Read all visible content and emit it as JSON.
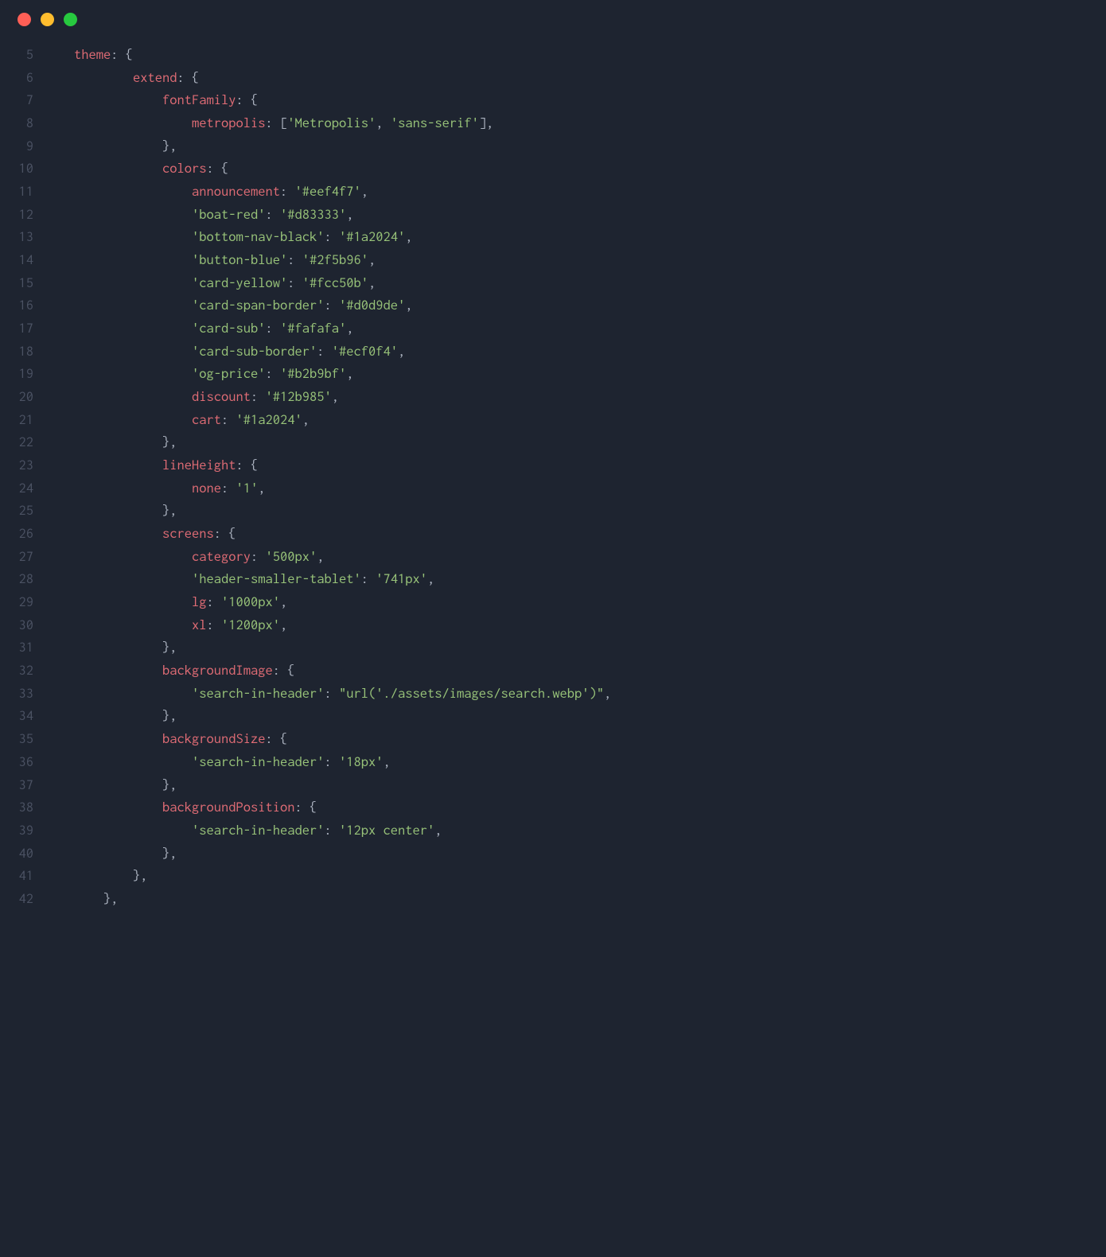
{
  "titlebar": {
    "red": "red",
    "yellow": "yellow",
    "green": "green"
  },
  "lines": [
    {
      "n": "5",
      "tokens": [
        {
          "t": "    ",
          "c": "punc"
        },
        {
          "t": "theme",
          "c": "key"
        },
        {
          "t": ": {",
          "c": "punc"
        }
      ]
    },
    {
      "n": "6",
      "tokens": [
        {
          "t": "            ",
          "c": "punc"
        },
        {
          "t": "extend",
          "c": "key"
        },
        {
          "t": ": {",
          "c": "punc"
        }
      ]
    },
    {
      "n": "7",
      "tokens": [
        {
          "t": "                ",
          "c": "punc"
        },
        {
          "t": "fontFamily",
          "c": "key"
        },
        {
          "t": ": {",
          "c": "punc"
        }
      ]
    },
    {
      "n": "8",
      "tokens": [
        {
          "t": "                    ",
          "c": "punc"
        },
        {
          "t": "metropolis",
          "c": "key"
        },
        {
          "t": ": [",
          "c": "punc"
        },
        {
          "t": "'Metropolis'",
          "c": "str"
        },
        {
          "t": ", ",
          "c": "punc"
        },
        {
          "t": "'sans-serif'",
          "c": "str"
        },
        {
          "t": "],",
          "c": "punc"
        }
      ]
    },
    {
      "n": "9",
      "tokens": [
        {
          "t": "                },",
          "c": "punc"
        }
      ]
    },
    {
      "n": "10",
      "tokens": [
        {
          "t": "                ",
          "c": "punc"
        },
        {
          "t": "colors",
          "c": "key"
        },
        {
          "t": ": {",
          "c": "punc"
        }
      ]
    },
    {
      "n": "11",
      "tokens": [
        {
          "t": "                    ",
          "c": "punc"
        },
        {
          "t": "announcement",
          "c": "key"
        },
        {
          "t": ": ",
          "c": "punc"
        },
        {
          "t": "'#eef4f7'",
          "c": "str"
        },
        {
          "t": ",",
          "c": "punc"
        }
      ]
    },
    {
      "n": "12",
      "tokens": [
        {
          "t": "                    ",
          "c": "punc"
        },
        {
          "t": "'boat-red'",
          "c": "str"
        },
        {
          "t": ": ",
          "c": "punc"
        },
        {
          "t": "'#d83333'",
          "c": "str"
        },
        {
          "t": ",",
          "c": "punc"
        }
      ]
    },
    {
      "n": "13",
      "tokens": [
        {
          "t": "                    ",
          "c": "punc"
        },
        {
          "t": "'bottom-nav-black'",
          "c": "str"
        },
        {
          "t": ": ",
          "c": "punc"
        },
        {
          "t": "'#1a2024'",
          "c": "str"
        },
        {
          "t": ",",
          "c": "punc"
        }
      ]
    },
    {
      "n": "14",
      "tokens": [
        {
          "t": "                    ",
          "c": "punc"
        },
        {
          "t": "'button-blue'",
          "c": "str"
        },
        {
          "t": ": ",
          "c": "punc"
        },
        {
          "t": "'#2f5b96'",
          "c": "str"
        },
        {
          "t": ",",
          "c": "punc"
        }
      ]
    },
    {
      "n": "15",
      "tokens": [
        {
          "t": "                    ",
          "c": "punc"
        },
        {
          "t": "'card-yellow'",
          "c": "str"
        },
        {
          "t": ": ",
          "c": "punc"
        },
        {
          "t": "'#fcc50b'",
          "c": "str"
        },
        {
          "t": ",",
          "c": "punc"
        }
      ]
    },
    {
      "n": "16",
      "tokens": [
        {
          "t": "                    ",
          "c": "punc"
        },
        {
          "t": "'card-span-border'",
          "c": "str"
        },
        {
          "t": ": ",
          "c": "punc"
        },
        {
          "t": "'#d0d9de'",
          "c": "str"
        },
        {
          "t": ",",
          "c": "punc"
        }
      ]
    },
    {
      "n": "17",
      "tokens": [
        {
          "t": "                    ",
          "c": "punc"
        },
        {
          "t": "'card-sub'",
          "c": "str"
        },
        {
          "t": ": ",
          "c": "punc"
        },
        {
          "t": "'#fafafa'",
          "c": "str"
        },
        {
          "t": ",",
          "c": "punc"
        }
      ]
    },
    {
      "n": "18",
      "tokens": [
        {
          "t": "                    ",
          "c": "punc"
        },
        {
          "t": "'card-sub-border'",
          "c": "str"
        },
        {
          "t": ": ",
          "c": "punc"
        },
        {
          "t": "'#ecf0f4'",
          "c": "str"
        },
        {
          "t": ",",
          "c": "punc"
        }
      ]
    },
    {
      "n": "19",
      "tokens": [
        {
          "t": "                    ",
          "c": "punc"
        },
        {
          "t": "'og-price'",
          "c": "str"
        },
        {
          "t": ": ",
          "c": "punc"
        },
        {
          "t": "'#b2b9bf'",
          "c": "str"
        },
        {
          "t": ",",
          "c": "punc"
        }
      ]
    },
    {
      "n": "20",
      "tokens": [
        {
          "t": "                    ",
          "c": "punc"
        },
        {
          "t": "discount",
          "c": "key"
        },
        {
          "t": ": ",
          "c": "punc"
        },
        {
          "t": "'#12b985'",
          "c": "str"
        },
        {
          "t": ",",
          "c": "punc"
        }
      ]
    },
    {
      "n": "21",
      "tokens": [
        {
          "t": "                    ",
          "c": "punc"
        },
        {
          "t": "cart",
          "c": "key"
        },
        {
          "t": ": ",
          "c": "punc"
        },
        {
          "t": "'#1a2024'",
          "c": "str"
        },
        {
          "t": ",",
          "c": "punc"
        }
      ]
    },
    {
      "n": "22",
      "tokens": [
        {
          "t": "                },",
          "c": "punc"
        }
      ]
    },
    {
      "n": "23",
      "tokens": [
        {
          "t": "                ",
          "c": "punc"
        },
        {
          "t": "lineHeight",
          "c": "key"
        },
        {
          "t": ": {",
          "c": "punc"
        }
      ]
    },
    {
      "n": "24",
      "tokens": [
        {
          "t": "                    ",
          "c": "punc"
        },
        {
          "t": "none",
          "c": "key"
        },
        {
          "t": ": ",
          "c": "punc"
        },
        {
          "t": "'1'",
          "c": "str"
        },
        {
          "t": ",",
          "c": "punc"
        }
      ]
    },
    {
      "n": "25",
      "tokens": [
        {
          "t": "                },",
          "c": "punc"
        }
      ]
    },
    {
      "n": "26",
      "tokens": [
        {
          "t": "                ",
          "c": "punc"
        },
        {
          "t": "screens",
          "c": "key"
        },
        {
          "t": ": {",
          "c": "punc"
        }
      ]
    },
    {
      "n": "27",
      "tokens": [
        {
          "t": "                    ",
          "c": "punc"
        },
        {
          "t": "category",
          "c": "key"
        },
        {
          "t": ": ",
          "c": "punc"
        },
        {
          "t": "'500px'",
          "c": "str"
        },
        {
          "t": ",",
          "c": "punc"
        }
      ]
    },
    {
      "n": "28",
      "tokens": [
        {
          "t": "                    ",
          "c": "punc"
        },
        {
          "t": "'header-smaller-tablet'",
          "c": "str"
        },
        {
          "t": ": ",
          "c": "punc"
        },
        {
          "t": "'741px'",
          "c": "str"
        },
        {
          "t": ",",
          "c": "punc"
        }
      ]
    },
    {
      "n": "29",
      "tokens": [
        {
          "t": "                    ",
          "c": "punc"
        },
        {
          "t": "lg",
          "c": "key"
        },
        {
          "t": ": ",
          "c": "punc"
        },
        {
          "t": "'1000px'",
          "c": "str"
        },
        {
          "t": ",",
          "c": "punc"
        }
      ]
    },
    {
      "n": "30",
      "tokens": [
        {
          "t": "                    ",
          "c": "punc"
        },
        {
          "t": "xl",
          "c": "key"
        },
        {
          "t": ": ",
          "c": "punc"
        },
        {
          "t": "'1200px'",
          "c": "str"
        },
        {
          "t": ",",
          "c": "punc"
        }
      ]
    },
    {
      "n": "31",
      "tokens": [
        {
          "t": "                },",
          "c": "punc"
        }
      ]
    },
    {
      "n": "32",
      "tokens": [
        {
          "t": "                ",
          "c": "punc"
        },
        {
          "t": "backgroundImage",
          "c": "key"
        },
        {
          "t": ": {",
          "c": "punc"
        }
      ]
    },
    {
      "n": "33",
      "tokens": [
        {
          "t": "                    ",
          "c": "punc"
        },
        {
          "t": "'search-in-header'",
          "c": "str"
        },
        {
          "t": ": ",
          "c": "punc"
        },
        {
          "t": "\"url('./assets/images/search.webp')\"",
          "c": "str"
        },
        {
          "t": ",",
          "c": "punc"
        }
      ]
    },
    {
      "n": "34",
      "tokens": [
        {
          "t": "                },",
          "c": "punc"
        }
      ]
    },
    {
      "n": "35",
      "tokens": [
        {
          "t": "                ",
          "c": "punc"
        },
        {
          "t": "backgroundSize",
          "c": "key"
        },
        {
          "t": ": {",
          "c": "punc"
        }
      ]
    },
    {
      "n": "36",
      "tokens": [
        {
          "t": "                    ",
          "c": "punc"
        },
        {
          "t": "'search-in-header'",
          "c": "str"
        },
        {
          "t": ": ",
          "c": "punc"
        },
        {
          "t": "'18px'",
          "c": "str"
        },
        {
          "t": ",",
          "c": "punc"
        }
      ]
    },
    {
      "n": "37",
      "tokens": [
        {
          "t": "                },",
          "c": "punc"
        }
      ]
    },
    {
      "n": "38",
      "tokens": [
        {
          "t": "                ",
          "c": "punc"
        },
        {
          "t": "backgroundPosition",
          "c": "key"
        },
        {
          "t": ": {",
          "c": "punc"
        }
      ]
    },
    {
      "n": "39",
      "tokens": [
        {
          "t": "                    ",
          "c": "punc"
        },
        {
          "t": "'search-in-header'",
          "c": "str"
        },
        {
          "t": ": ",
          "c": "punc"
        },
        {
          "t": "'12px center'",
          "c": "str"
        },
        {
          "t": ",",
          "c": "punc"
        }
      ]
    },
    {
      "n": "40",
      "tokens": [
        {
          "t": "                },",
          "c": "punc"
        }
      ]
    },
    {
      "n": "41",
      "tokens": [
        {
          "t": "            },",
          "c": "punc"
        }
      ]
    },
    {
      "n": "42",
      "tokens": [
        {
          "t": "        },",
          "c": "punc"
        }
      ]
    }
  ]
}
